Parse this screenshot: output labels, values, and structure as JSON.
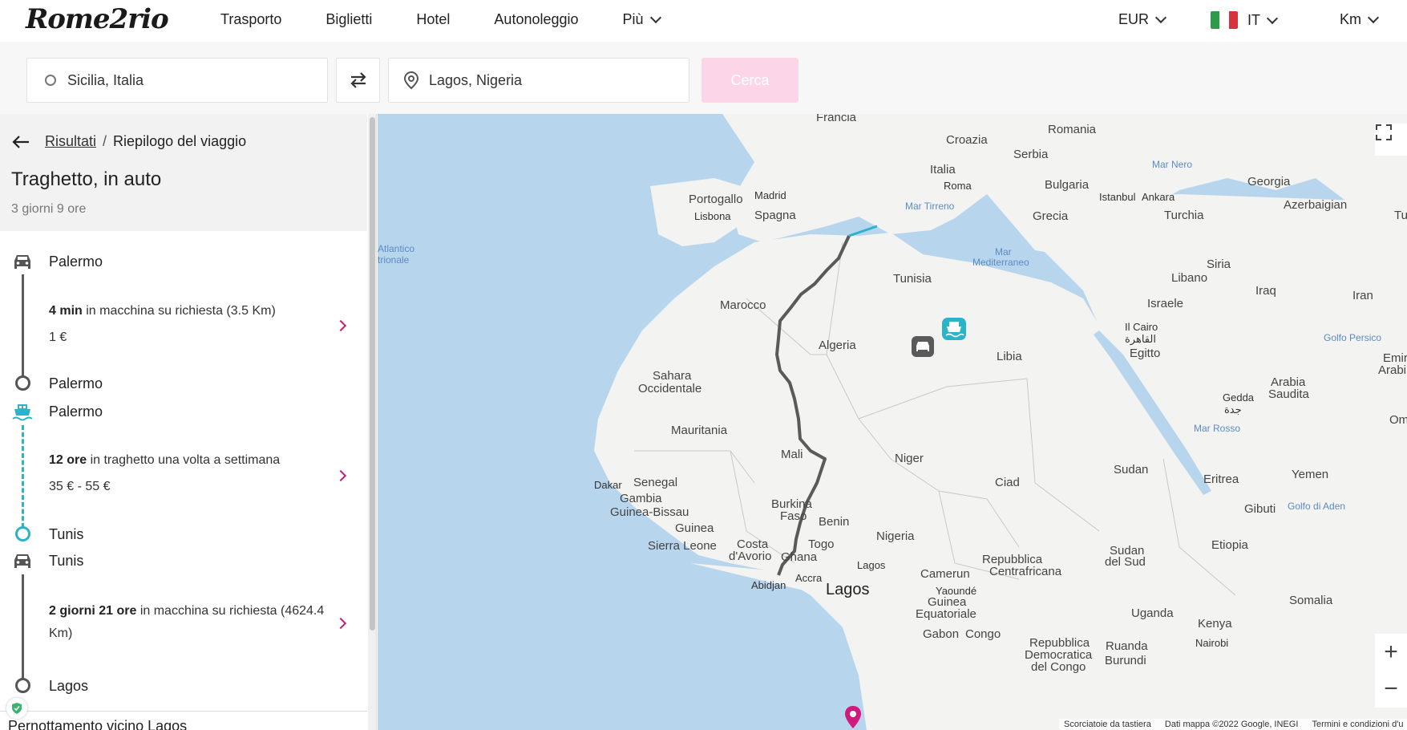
{
  "brand": {
    "logo_text": "Rome2rio"
  },
  "nav": {
    "items": [
      "Trasporto",
      "Biglietti",
      "Hotel",
      "Autonoleggio"
    ],
    "more": "Più"
  },
  "controls": {
    "currency": "EUR",
    "language": "IT",
    "units": "Km"
  },
  "search": {
    "from": "Sicilia, Italia",
    "to": "Lagos, Nigeria",
    "button": "Cerca"
  },
  "panel": {
    "breadcrumb_link": "Risultati",
    "breadcrumb_sep": "/",
    "breadcrumb_current": "Riepilogo del viaggio",
    "title": "Traghetto, in auto",
    "duration": "3 giorni 9 ore",
    "stops": {
      "s1": "Palermo",
      "s2": "Palermo",
      "s3": "Palermo",
      "s4": "Tunis",
      "s5": "Tunis",
      "s6": "Lagos"
    },
    "segments": {
      "car1": {
        "time": "4 min",
        "desc": " in macchina su richiesta (3.5 Km)",
        "price": "1 €"
      },
      "ferry": {
        "time": "12 ore",
        "desc": " in traghetto una volta a settimana",
        "price": "35 € - 55 €"
      },
      "car2": {
        "time": "2 giorni 21 ore",
        "desc": " in macchina su richiesta (4624.4 Km)"
      }
    },
    "bottom_text": "Pernottamento vicino Lagos"
  },
  "map": {
    "labels": {
      "francia": "Francia",
      "croazia": "Croazia",
      "romania": "Romania",
      "serbia": "Serbia",
      "italia": "Italia",
      "roma": "Roma",
      "bulgaria": "Bulgaria",
      "mar_nero": "Mar Nero",
      "georgia": "Georgia",
      "portogallo": "Portogallo",
      "madrid": "Madrid",
      "spagna": "Spagna",
      "lisbona": "Lisbona",
      "mar_tirreno": "Mar Tirreno",
      "istanbul": "Istanbul",
      "ankara": "Ankara",
      "turchia": "Turchia",
      "grecia": "Grecia",
      "azerbaigian": "Azerbaigian",
      "atlantico": "Atlantico",
      "trionale": "trionale",
      "tunisia": "Tunisia",
      "mar_med": "Mar",
      "mar_med2": "Mediterraneo",
      "siria": "Siria",
      "libano": "Libano",
      "iraq": "Iraq",
      "iran": "Iran",
      "marocco": "Marocco",
      "israele": "Israele",
      "il_cairo": "Il Cairo",
      "cairo_ar": "القاهرة",
      "egitto": "Egitto",
      "algeria": "Algeria",
      "libia": "Libia",
      "golfo_persico": "Golfo Persico",
      "emirati": "Emirati",
      "arabi_uniti": "Arabi Uni",
      "sahara": "Sahara",
      "occidentale": "Occidentale",
      "gedda": "Gedda",
      "gedda_ar": "جدة",
      "arabia": "Arabia",
      "saudita": "Saudita",
      "mauritania": "Mauritania",
      "mar_rosso": "Mar Rosso",
      "om": "Om",
      "mali": "Mali",
      "niger": "Niger",
      "senegal": "Senegal",
      "dakar": "Dakar",
      "sudan": "Sudan",
      "eritrea": "Eritrea",
      "yemen": "Yemen",
      "ciad": "Ciad",
      "gambia": "Gambia",
      "guinea_bissau": "Guinea-Bissau",
      "burkina": "Burkina",
      "faso": "Faso",
      "gibuti": "Gibuti",
      "golfo_aden": "Golfo di Aden",
      "guinea": "Guinea",
      "benin": "Benin",
      "nigeria": "Nigeria",
      "costa": "Costa",
      "davorio": "d'Avorio",
      "sierra_leone": "Sierra Leone",
      "togo": "Togo",
      "ghana": "Ghana",
      "etiopia": "Etiopia",
      "sudan_del": "Sudan",
      "del_sud": "del Sud",
      "repubblica": "Repubblica",
      "centrafricana": "Centrafricana",
      "lagos_small": "Lagos",
      "camerun": "Camerun",
      "abidjan": "Abidjan",
      "accra": "Accra",
      "lagos_big": "Lagos",
      "yaounde": "Yaoundé",
      "somalia": "Somalia",
      "guinea_eq1": "Guinea",
      "guinea_eq2": "Equatoriale",
      "uganda": "Uganda",
      "gabon": "Gabon",
      "congo": "Congo",
      "kenya": "Kenya",
      "rep_dem1": "Repubblica",
      "rep_dem2": "Democratica",
      "rep_dem3": "del Congo",
      "ruanda": "Ruanda",
      "burundi": "Burundi",
      "nairobi": "Nairobi",
      "tu": "Tu"
    },
    "attribution": {
      "shortcuts": "Scorciatoie da tastiera",
      "data": "Dati mappa ©2022 Google, INEGI",
      "terms": "Termini e condizioni d'u"
    }
  },
  "colors": {
    "accent": "#c81e78",
    "ferry": "#2bb3c8",
    "car_route": "#5a5a5a",
    "cta_disabled": "#fcd6e8",
    "sea": "#b8d5ee",
    "land": "#f3f3f1"
  }
}
